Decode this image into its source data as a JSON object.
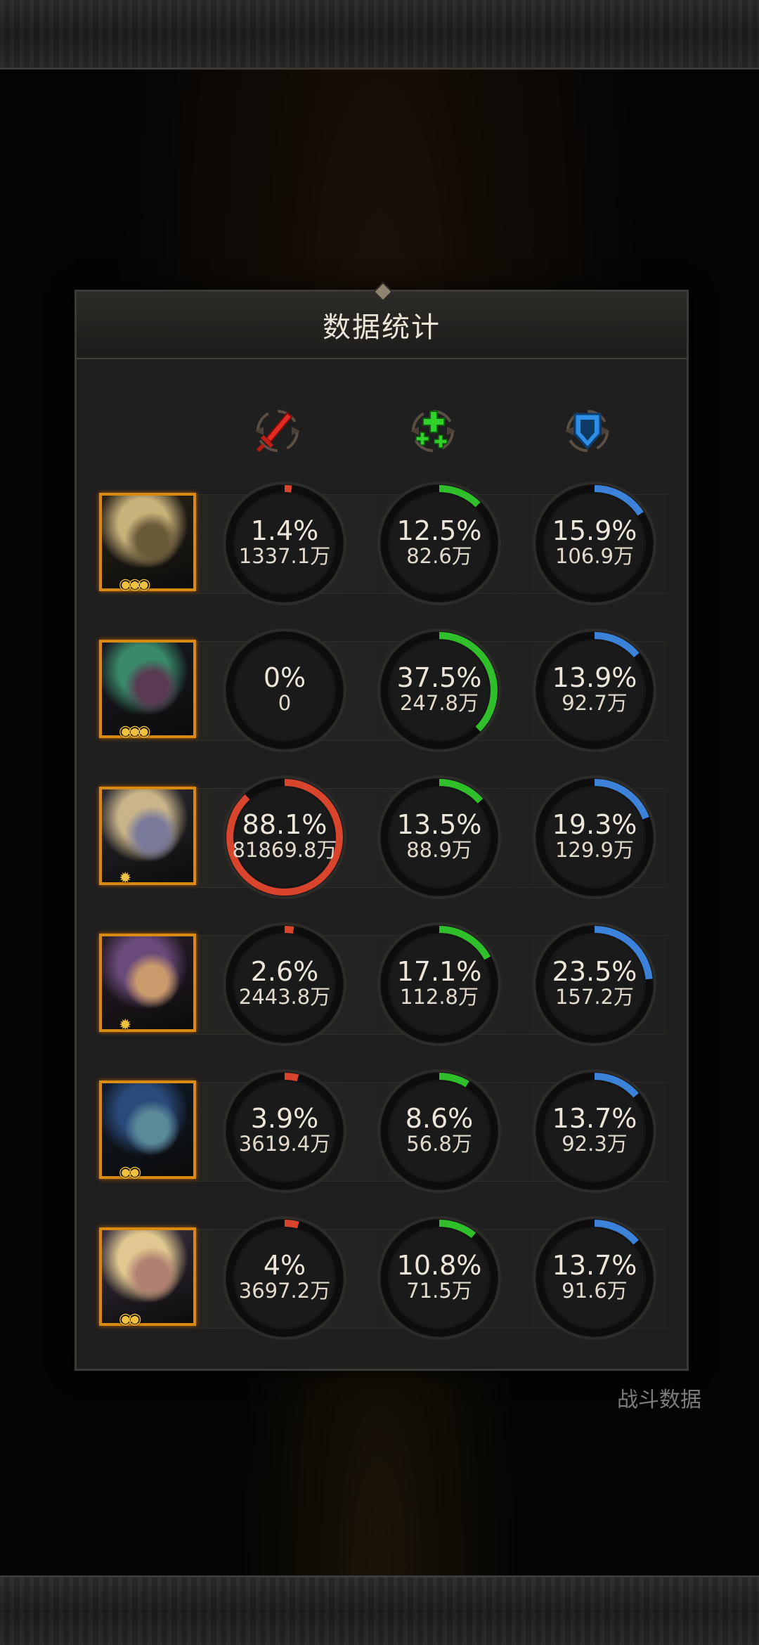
{
  "panel": {
    "title": "数据统计"
  },
  "background": {
    "battle_data_label": "战斗数据"
  },
  "columns": [
    {
      "name": "damage",
      "icon": "sword-icon",
      "color": "#e23a2a"
    },
    {
      "name": "heal",
      "icon": "heal-cross-icon",
      "color": "#2ecc2a"
    },
    {
      "name": "tank",
      "icon": "shield-icon",
      "color": "#3a8fe0"
    }
  ],
  "colors": {
    "damage": "#d8442c",
    "heal": "#2fbf2a",
    "tank": "#3b82d8",
    "portrait_border": "#d98a12"
  },
  "heroes": [
    {
      "portrait": "hero-portrait-blonde-archer",
      "stars": "◉◉◉",
      "damage": {
        "pct": "1.4%",
        "amount": "1337.1万",
        "ratio": 0.014
      },
      "heal": {
        "pct": "12.5%",
        "amount": "82.6万",
        "ratio": 0.125
      },
      "tank": {
        "pct": "15.9%",
        "amount": "106.9万",
        "ratio": 0.159
      }
    },
    {
      "portrait": "hero-portrait-antlered-elf",
      "stars": "◉◉◉",
      "damage": {
        "pct": "0%",
        "amount": "0",
        "ratio": 0
      },
      "heal": {
        "pct": "37.5%",
        "amount": "247.8万",
        "ratio": 0.375
      },
      "tank": {
        "pct": "13.9%",
        "amount": "92.7万",
        "ratio": 0.139
      }
    },
    {
      "portrait": "hero-portrait-crowned-elf",
      "stars": "✹",
      "damage": {
        "pct": "88.1%",
        "amount": "81869.8万",
        "ratio": 0.881
      },
      "heal": {
        "pct": "13.5%",
        "amount": "88.9万",
        "ratio": 0.135
      },
      "tank": {
        "pct": "19.3%",
        "amount": "129.9万",
        "ratio": 0.193
      }
    },
    {
      "portrait": "hero-portrait-hooded-girl",
      "stars": "✹",
      "damage": {
        "pct": "2.6%",
        "amount": "2443.8万",
        "ratio": 0.026
      },
      "heal": {
        "pct": "17.1%",
        "amount": "112.8万",
        "ratio": 0.171
      },
      "tank": {
        "pct": "23.5%",
        "amount": "157.2万",
        "ratio": 0.235
      }
    },
    {
      "portrait": "hero-portrait-blue-warrior",
      "stars": "◉◉",
      "damage": {
        "pct": "3.9%",
        "amount": "3619.4万",
        "ratio": 0.039
      },
      "heal": {
        "pct": "8.6%",
        "amount": "56.8万",
        "ratio": 0.086
      },
      "tank": {
        "pct": "13.7%",
        "amount": "92.3万",
        "ratio": 0.137
      }
    },
    {
      "portrait": "hero-portrait-flower-maiden",
      "stars": "◉◉",
      "damage": {
        "pct": "4%",
        "amount": "3697.2万",
        "ratio": 0.04
      },
      "heal": {
        "pct": "10.8%",
        "amount": "71.5万",
        "ratio": 0.108
      },
      "tank": {
        "pct": "13.7%",
        "amount": "91.6万",
        "ratio": 0.137
      }
    }
  ]
}
